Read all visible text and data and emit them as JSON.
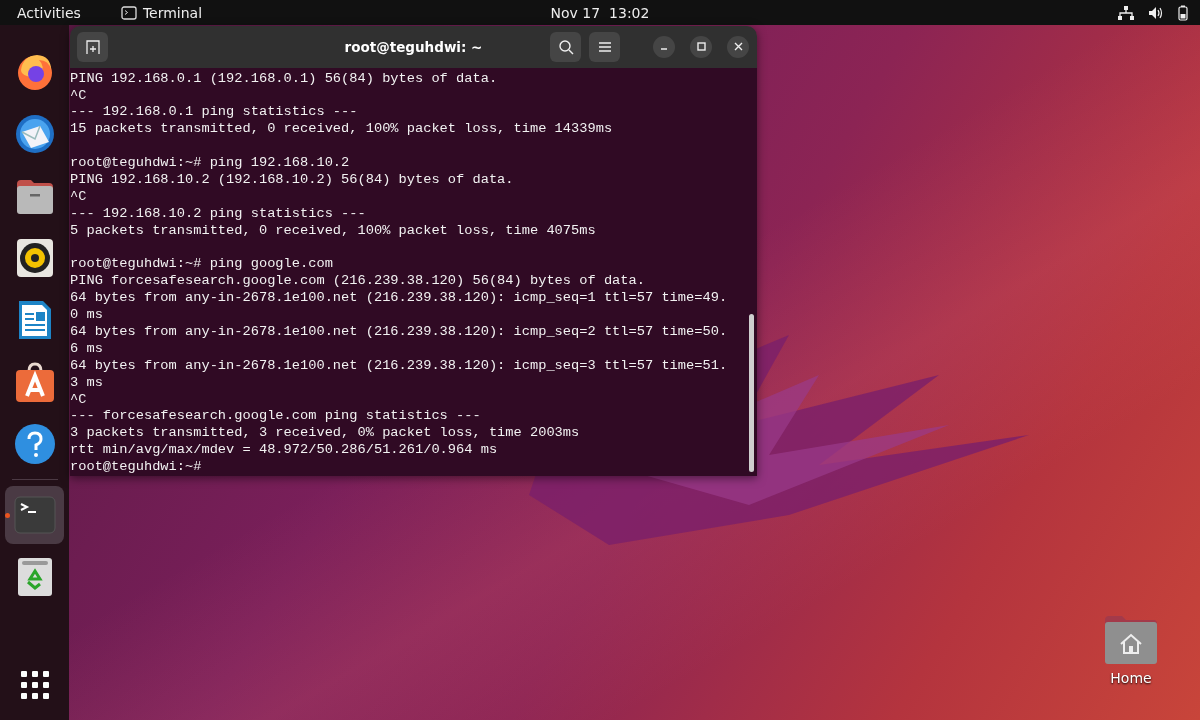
{
  "top_bar": {
    "activities": "Activities",
    "app_menu": "Terminal",
    "clock": "Nov 17  13:02"
  },
  "dock": [
    {
      "running": false,
      "selected": false
    },
    {
      "running": false,
      "selected": false
    },
    {
      "running": false,
      "selected": false
    },
    {
      "running": false,
      "selected": false
    },
    {
      "running": false,
      "selected": false
    },
    {
      "running": false,
      "selected": false
    },
    {
      "running": false,
      "selected": false
    },
    {
      "running": true,
      "selected": true
    },
    {
      "running": false,
      "selected": false
    }
  ],
  "terminal": {
    "title": "root@teguhdwi: ~",
    "blocks": [
      [
        "PING 192.168.0.1 (192.168.0.1) 56(84) bytes of data.",
        "^C",
        "--- 192.168.0.1 ping statistics ---",
        "15 packets transmitted, 0 received, 100% packet loss, time 14339ms"
      ],
      [
        "root@teguhdwi:~# ping 192.168.10.2",
        "PING 192.168.10.2 (192.168.10.2) 56(84) bytes of data.",
        "^C",
        "--- 192.168.10.2 ping statistics ---",
        "5 packets transmitted, 0 received, 100% packet loss, time 4075ms"
      ],
      [
        "root@teguhdwi:~# ping google.com",
        "PING forcesafesearch.google.com (216.239.38.120) 56(84) bytes of data.",
        "64 bytes from any-in-2678.1e100.net (216.239.38.120): icmp_seq=1 ttl=57 time=49.",
        "0 ms",
        "64 bytes from any-in-2678.1e100.net (216.239.38.120): icmp_seq=2 ttl=57 time=50.",
        "6 ms",
        "64 bytes from any-in-2678.1e100.net (216.239.38.120): icmp_seq=3 ttl=57 time=51.",
        "3 ms",
        "^C",
        "--- forcesafesearch.google.com ping statistics ---",
        "3 packets transmitted, 3 received, 0% packet loss, time 2003ms",
        "rtt min/avg/max/mdev = 48.972/50.286/51.261/0.964 ms",
        "root@teguhdwi:~#"
      ]
    ]
  },
  "desktop_icons": [
    {
      "label": "Home"
    }
  ]
}
